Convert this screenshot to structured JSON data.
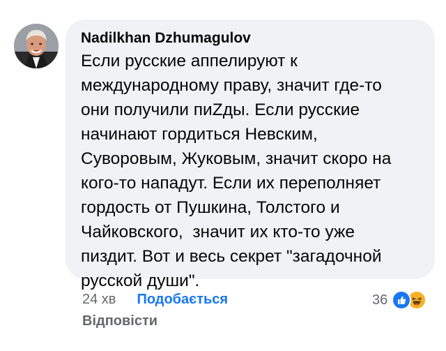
{
  "comment": {
    "author": "Nadilkhan Dzhumagulov",
    "text": "Если русские аппелируют к\nмеждународному праву, значит где-то\nони получили пиZды. Если русские\nначинают гордиться Невским,\nСуворовым, Жуковым, значит скоро на\nкого-то нападут. Если их переполняет\nгордость от Пушкина, Толстого и\nЧайковского,  значит их кто-то уже\nпиздит. Вот и весь секрет \"загадочной\nрусской души\"."
  },
  "actions": {
    "time": "24 хв",
    "like_label": "Подобається",
    "reply_label": "Відповісти"
  },
  "reactions": {
    "count": "36",
    "icons": [
      "like-icon",
      "haha-icon"
    ],
    "like_color": "#1877f2",
    "haha_color": "#f7b125"
  },
  "colors": {
    "bubble": "#f0f2f5",
    "text": "#050505",
    "secondary": "#65676b",
    "link": "#1877f2"
  }
}
